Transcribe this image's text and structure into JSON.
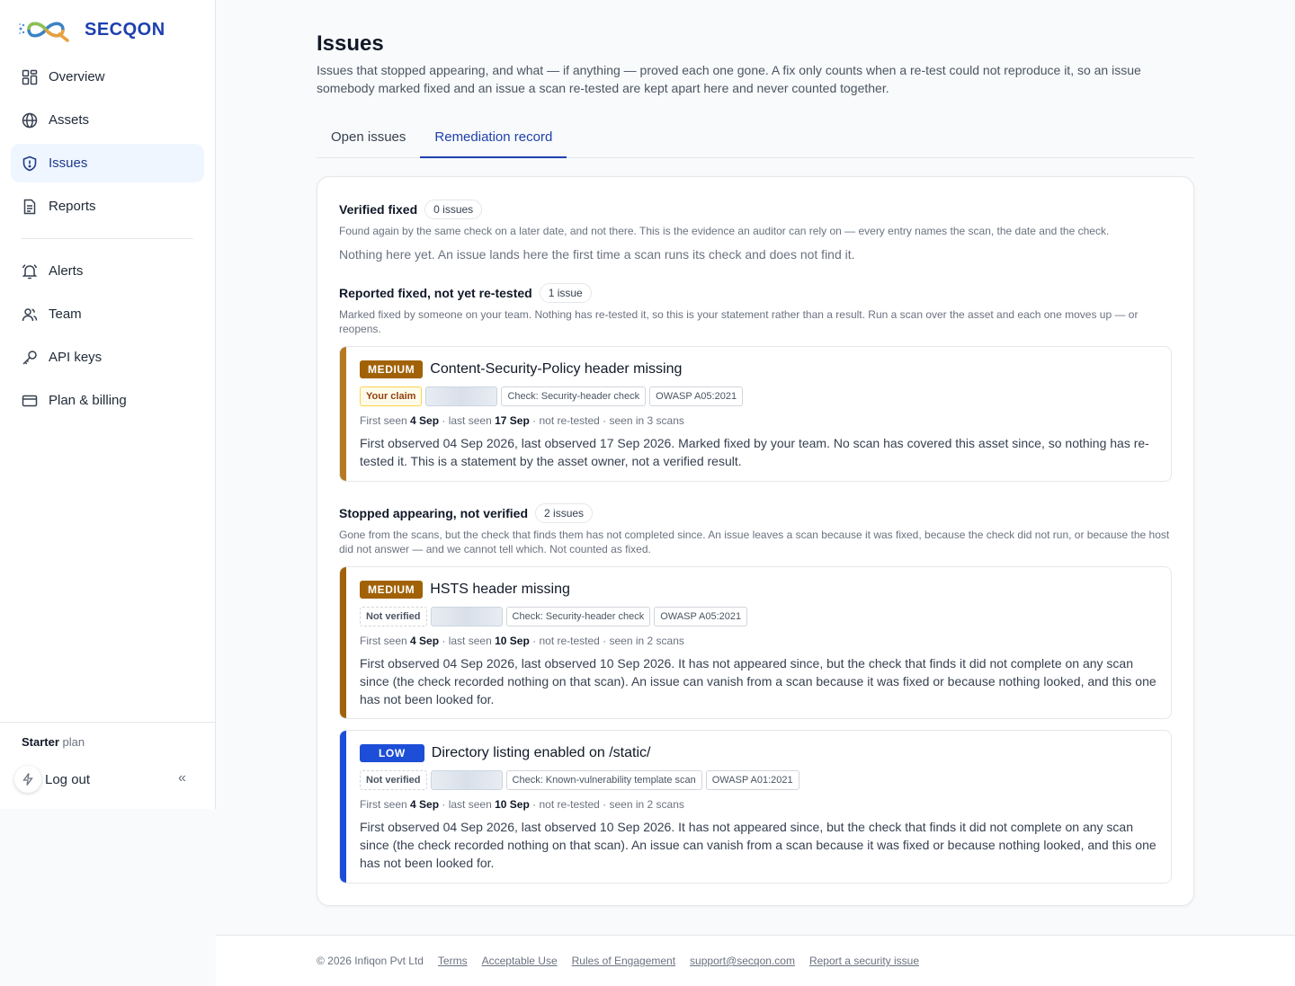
{
  "brand": {
    "name": "SECQON"
  },
  "sidebar": {
    "items": [
      {
        "label": "Overview",
        "icon": "grid-icon"
      },
      {
        "label": "Assets",
        "icon": "globe-icon"
      },
      {
        "label": "Issues",
        "icon": "shield-icon",
        "active": true
      },
      {
        "label": "Reports",
        "icon": "document-icon"
      }
    ],
    "items2": [
      {
        "label": "Alerts",
        "icon": "bell-icon"
      },
      {
        "label": "Team",
        "icon": "users-icon"
      },
      {
        "label": "API keys",
        "icon": "key-icon"
      },
      {
        "label": "Plan & billing",
        "icon": "credit-card-icon"
      }
    ],
    "plan_name": "Starter",
    "plan_suffix": "plan",
    "logout": "Log out",
    "collapse": "«"
  },
  "header": {
    "title": "Issues",
    "subtitle": "Issues that stopped appearing, and what — if anything — proved each one gone. A fix only counts when a re-test could not reproduce it, so an issue somebody marked fixed and an issue a scan re-tested are kept apart here and never counted together."
  },
  "tabs": [
    {
      "label": "Open issues"
    },
    {
      "label": "Remediation record",
      "active": true
    }
  ],
  "sections": {
    "verified": {
      "title": "Verified fixed",
      "count": "0 issues",
      "desc": "Found again by the same check on a later date, and not there. This is the evidence an auditor can rely on — every entry names the scan, the date and the check.",
      "empty": "Nothing here yet. An issue lands here the first time a scan runs its check and does not find it."
    },
    "reported": {
      "title": "Reported fixed, not yet re-tested",
      "count": "1 issue",
      "desc": "Marked fixed by someone on your team. Nothing has re-tested it, so this is your statement rather than a result. Run a scan over the asset and each one moves up — or reopens."
    },
    "stopped": {
      "title": "Stopped appearing, not verified",
      "count": "2 issues",
      "desc": "Gone from the scans, but the check that finds them has not completed since. An issue leaves a scan because it was fixed, because the check did not run, or because the host did not answer — and we cannot tell which. Not counted as fixed."
    }
  },
  "cards": [
    {
      "severity": "MEDIUM",
      "severity_color": "#a16207",
      "bar_color": "#b7791f",
      "title": "Content-Security-Policy header missing",
      "status_tag": "Your claim",
      "check": "Check: Security-header check",
      "owasp": "OWASP A05:2021",
      "meta_first_label": "First seen",
      "first_seen": "4 Sep",
      "meta_last_label": "· last seen",
      "last_seen": "17 Sep",
      "meta_rest": "· not re-tested · seen in 3 scans",
      "desc": "First observed 04 Sep 2026, last observed 17 Sep 2026. Marked fixed by your team. No scan has covered this asset since, so nothing has re-tested it. This is a statement by the asset owner, not a verified result."
    },
    {
      "severity": "MEDIUM",
      "severity_color": "#a16207",
      "bar_color": "#a16207",
      "title": "HSTS header missing",
      "status_tag": "Not verified",
      "check": "Check: Security-header check",
      "owasp": "OWASP A05:2021",
      "meta_first_label": "First seen",
      "first_seen": "4 Sep",
      "meta_last_label": "· last seen",
      "last_seen": "10 Sep",
      "meta_rest": "· not re-tested · seen in 2 scans",
      "desc": "First observed 04 Sep 2026, last observed 10 Sep 2026. It has not appeared since, but the check that finds it did not complete on any scan since (the check recorded nothing on that scan). An issue can vanish from a scan because it was fixed or because nothing looked, and this one has not been looked for."
    },
    {
      "severity": "LOW",
      "severity_color": "#1d4ed8",
      "bar_color": "#1d4ed8",
      "title": "Directory listing enabled on /static/",
      "status_tag": "Not verified",
      "check": "Check: Known-vulnerability template scan",
      "owasp": "OWASP A01:2021",
      "meta_first_label": "First seen",
      "first_seen": "4 Sep",
      "meta_last_label": "· last seen",
      "last_seen": "10 Sep",
      "meta_rest": "· not re-tested · seen in 2 scans",
      "desc": "First observed 04 Sep 2026, last observed 10 Sep 2026. It has not appeared since, but the check that finds it did not complete on any scan since (the check recorded nothing on that scan). An issue can vanish from a scan because it was fixed or because nothing looked, and this one has not been looked for."
    }
  ],
  "footer": {
    "copyright": "© 2026 Infiqon Pvt Ltd",
    "links": [
      "Terms",
      "Acceptable Use",
      "Rules of Engagement",
      "support@secqon.com",
      "Report a security issue"
    ]
  }
}
